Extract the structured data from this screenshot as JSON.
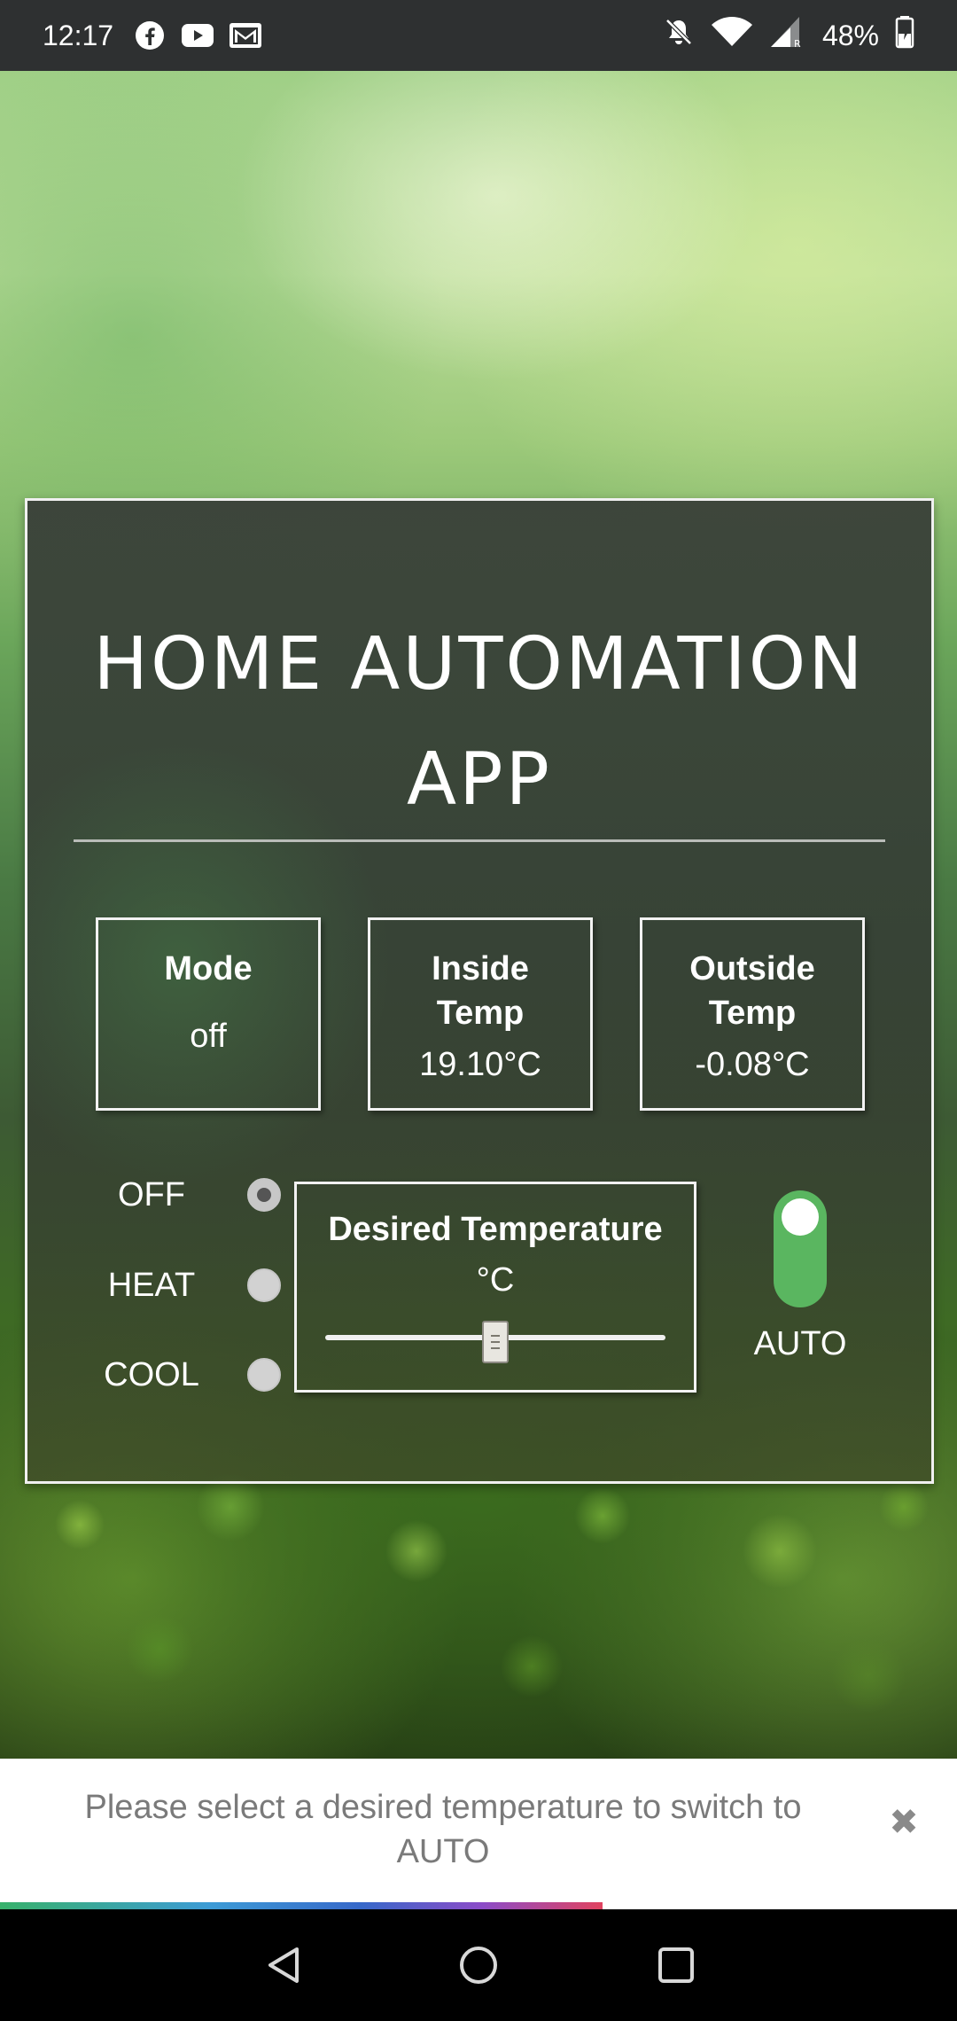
{
  "status_bar": {
    "time": "12:17",
    "left_icons": [
      "facebook-icon",
      "youtube-icon",
      "gmail-icon"
    ],
    "right_icons": [
      "do-not-disturb-bell-icon",
      "wifi-icon",
      "signal-icon",
      "battery-icon"
    ],
    "battery_percent": "48%",
    "battery_level": 0.48
  },
  "app": {
    "title_line1": "HOME AUTOMATION",
    "title_line2": "APP"
  },
  "info_boxes": {
    "mode": {
      "label": "Mode",
      "value": "off"
    },
    "inside": {
      "label_line1": "Inside",
      "label_line2": "Temp",
      "value": "19.10°C"
    },
    "outside": {
      "label_line1": "Outside",
      "label_line2": "Temp",
      "value": "-0.08°C"
    }
  },
  "mode_options": {
    "selected": "OFF",
    "items": [
      "OFF",
      "HEAT",
      "COOL"
    ]
  },
  "desired_temperature": {
    "label": "Desired Temperature",
    "unit": "°C",
    "slider_fraction": 0.5
  },
  "auto_toggle": {
    "label": "AUTO",
    "on": true,
    "color": "#5ab660"
  },
  "toast": {
    "message": "Please select a desired temperature to switch to AUTO",
    "close_icon": "close-icon",
    "progress_fraction": 0.63
  },
  "nav_bar": {
    "icons": [
      "back-icon",
      "home-icon",
      "recents-icon"
    ]
  }
}
